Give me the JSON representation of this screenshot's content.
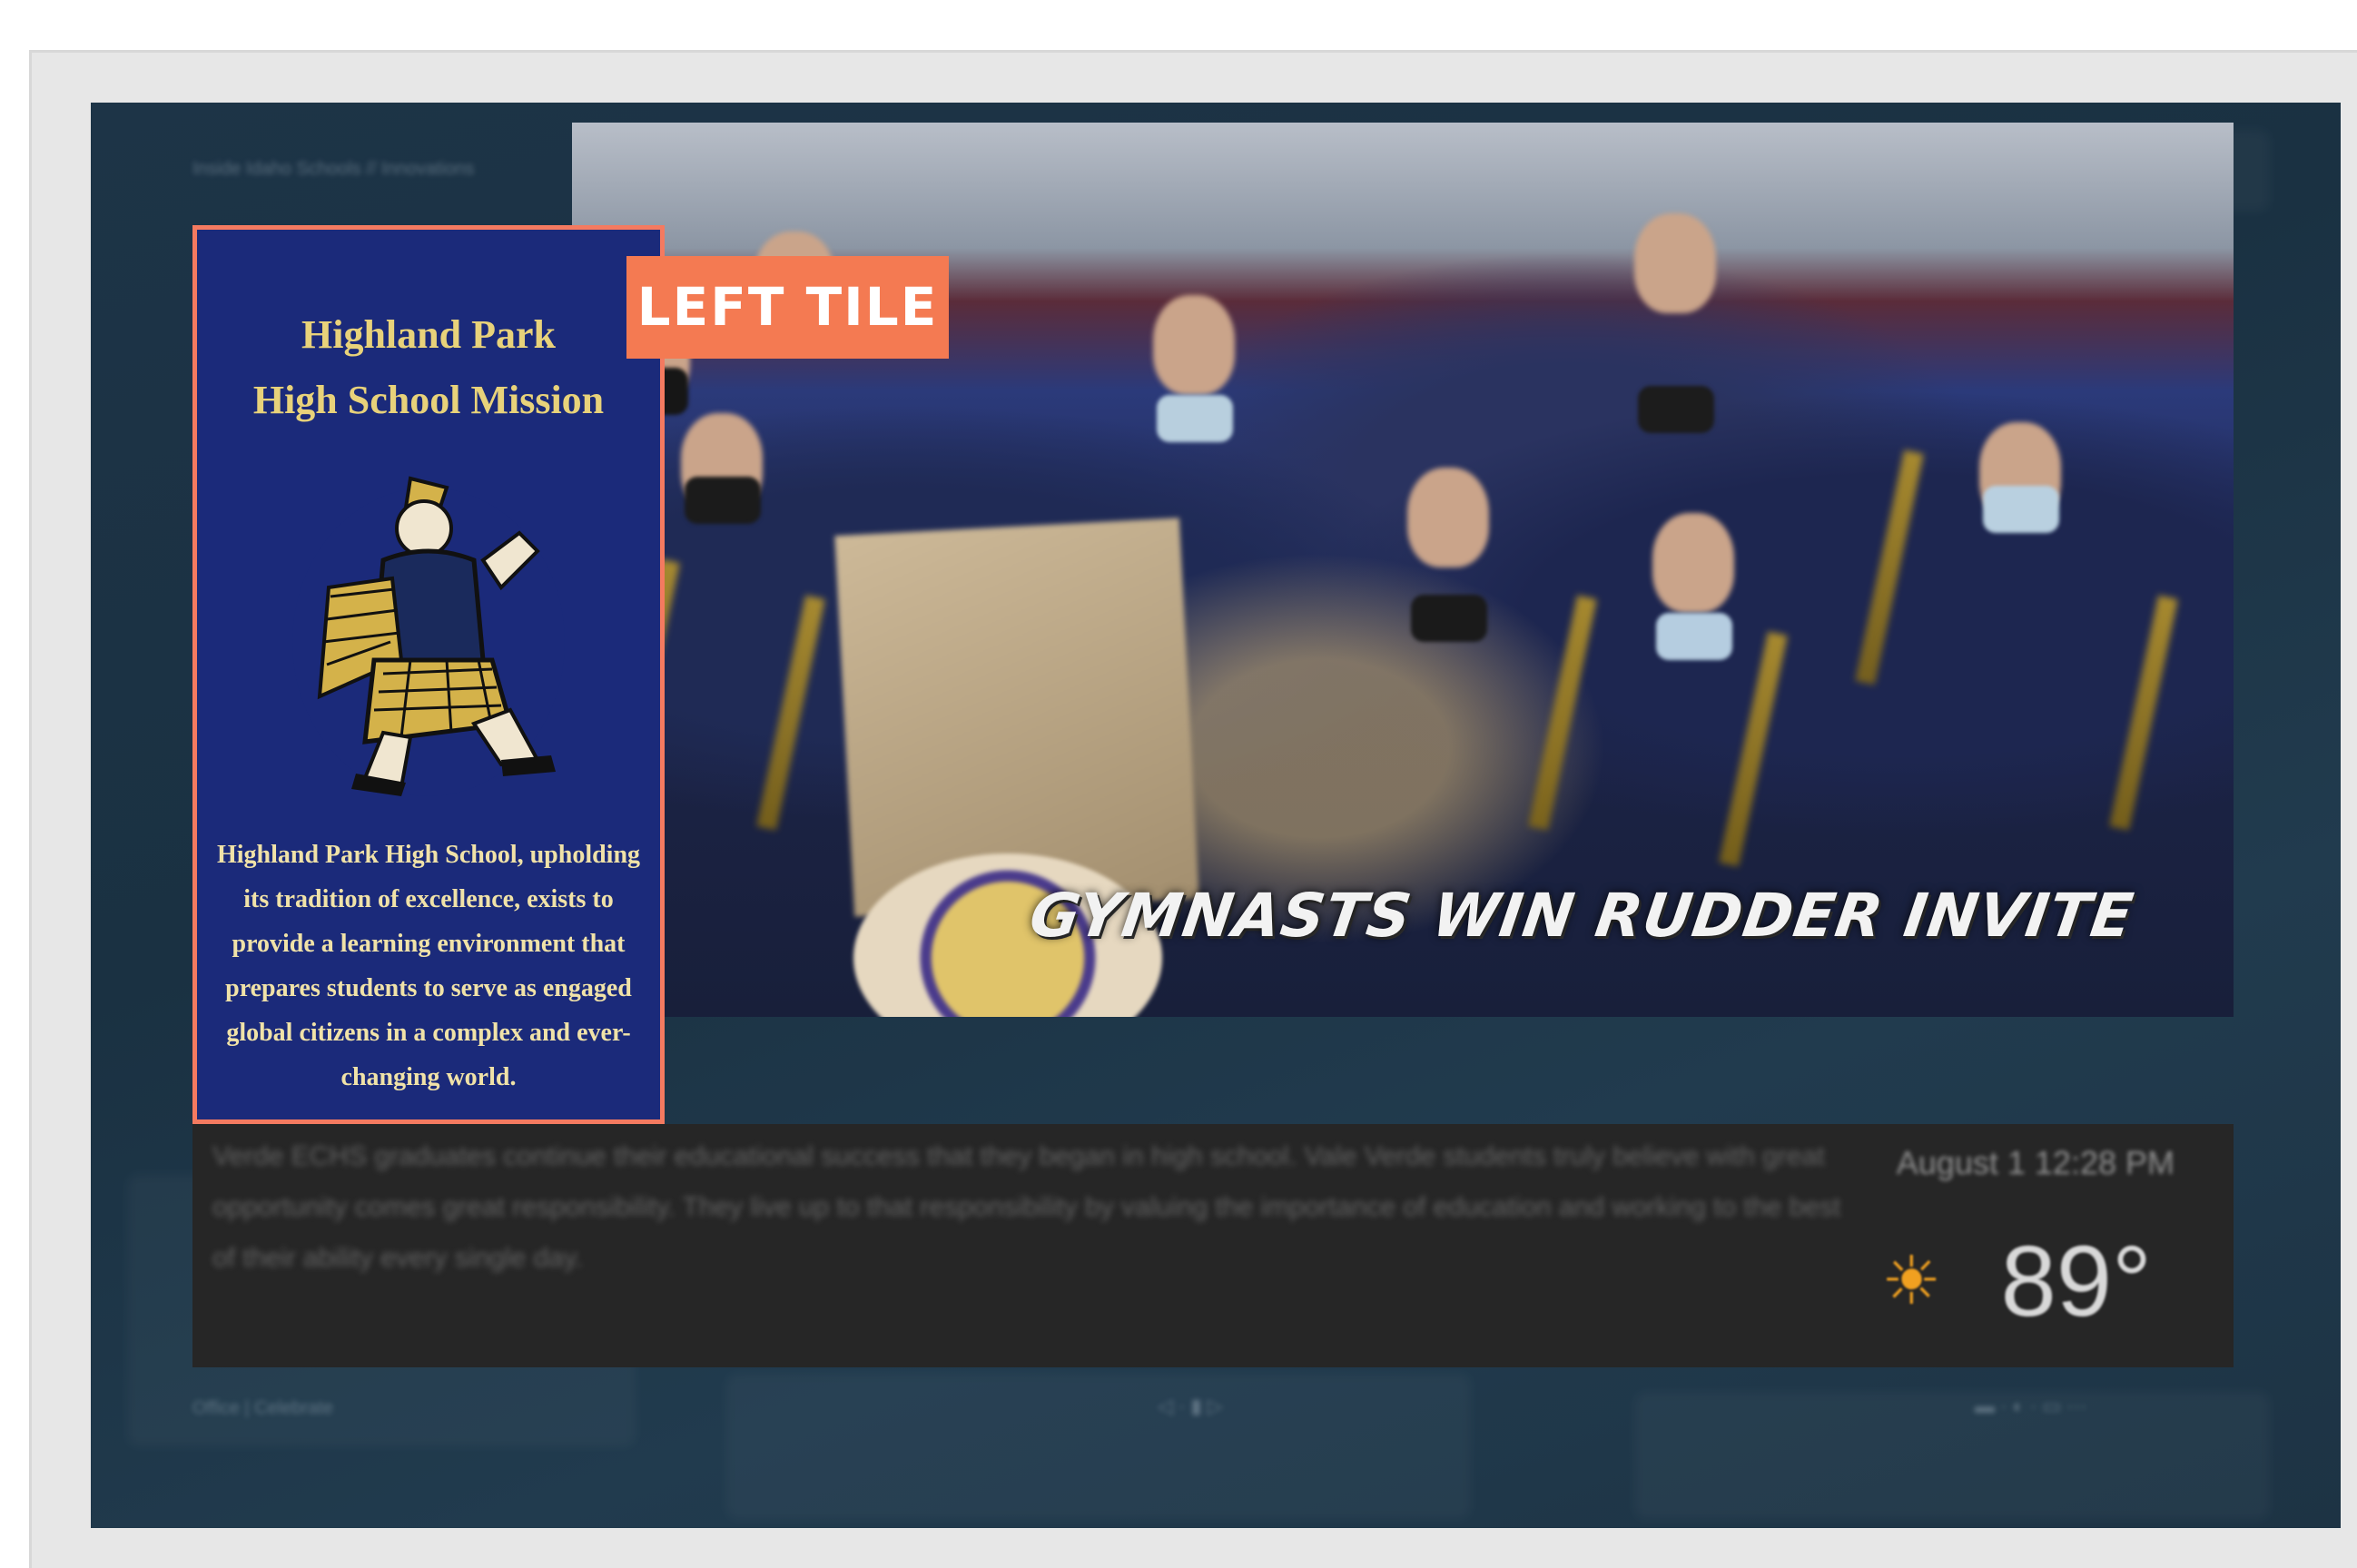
{
  "breadcrumb": "Inside Idaho Schools   //  Innovations",
  "left_tile": {
    "tag_label": "LEFT TILE",
    "title_line1": "Highland Park",
    "title_line2": "High School Mission",
    "mission_text": "Highland Park High School, upholding its tradition of excellence, exists to provide a learning environment that prepares students to serve as engaged global citizens in a complex and ever-changing world.",
    "border_color": "#f47a60",
    "background_color": "#1b2a7a"
  },
  "main_slide": {
    "headline": "GYMNASTS WIN RUDDER INVITE"
  },
  "footer": {
    "ticker_text": "Verde ECHS graduates continue their educational success that they began in high school. Vale Verde students truly believe with great opportunity comes great responsibility. They live up to that responsibility by valuing the importance of education and working to the best of their ability every single day.",
    "datetime": "August 1 12:28 PM",
    "temperature": "89°",
    "weather_icon": "sun-icon"
  },
  "status_bar": {
    "left_text": "Office | Celebrate",
    "mid_text": "◁  ·  ▮  ▷",
    "right_text": "▬  ·  ◐  ·  ▭  ···"
  }
}
